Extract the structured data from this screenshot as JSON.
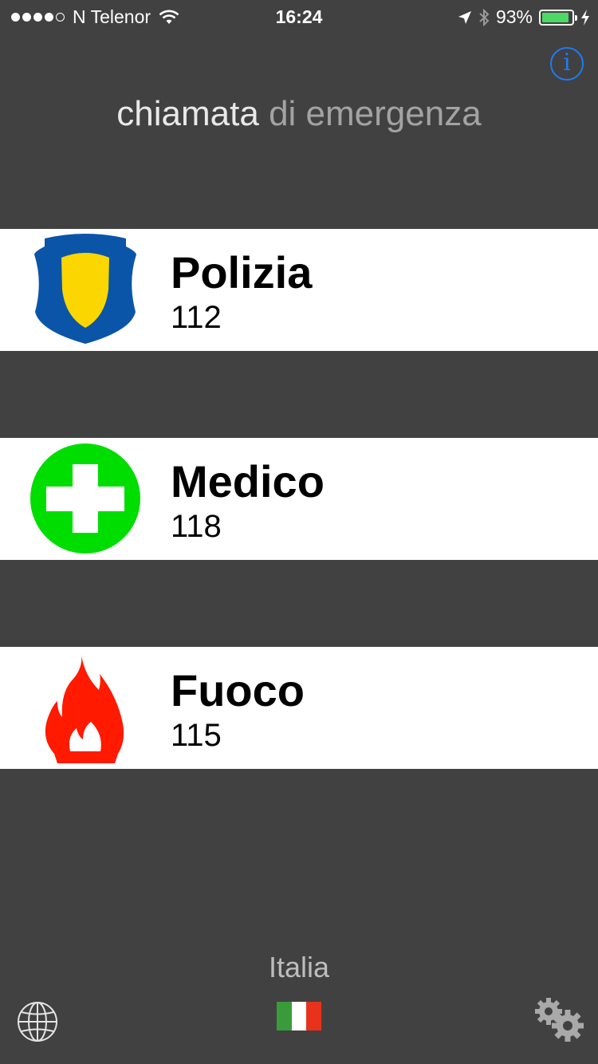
{
  "status_bar": {
    "carrier": "N Telenor",
    "time": "16:24",
    "battery_percent": "93%",
    "battery_level": 0.93,
    "signal_bars": 4,
    "signal_max": 5,
    "icons": [
      "wifi-icon",
      "location-arrow-icon",
      "bluetooth-icon",
      "battery-icon",
      "charging-bolt-icon"
    ]
  },
  "header": {
    "title_part1": "chiamata",
    "title_part2": "di emergenza",
    "info_label": "i"
  },
  "services": [
    {
      "name": "Polizia",
      "number": "112",
      "icon": "police-badge-icon"
    },
    {
      "name": "Medico",
      "number": "118",
      "icon": "medical-cross-icon"
    },
    {
      "name": "Fuoco",
      "number": "115",
      "icon": "fire-icon"
    }
  ],
  "footer": {
    "country": "Italia",
    "flag_colors": [
      "#3a9b3a",
      "#ffffff",
      "#e8321c"
    ],
    "globe_icon": "globe-icon",
    "settings_icon": "settings-gears-icon"
  },
  "colors": {
    "background": "#414141",
    "accent": "#1e7bf0",
    "police_blue": "#0a55a8",
    "police_yellow": "#fbd600",
    "medical_green": "#00dd00",
    "fire_red": "#ff1a00"
  }
}
